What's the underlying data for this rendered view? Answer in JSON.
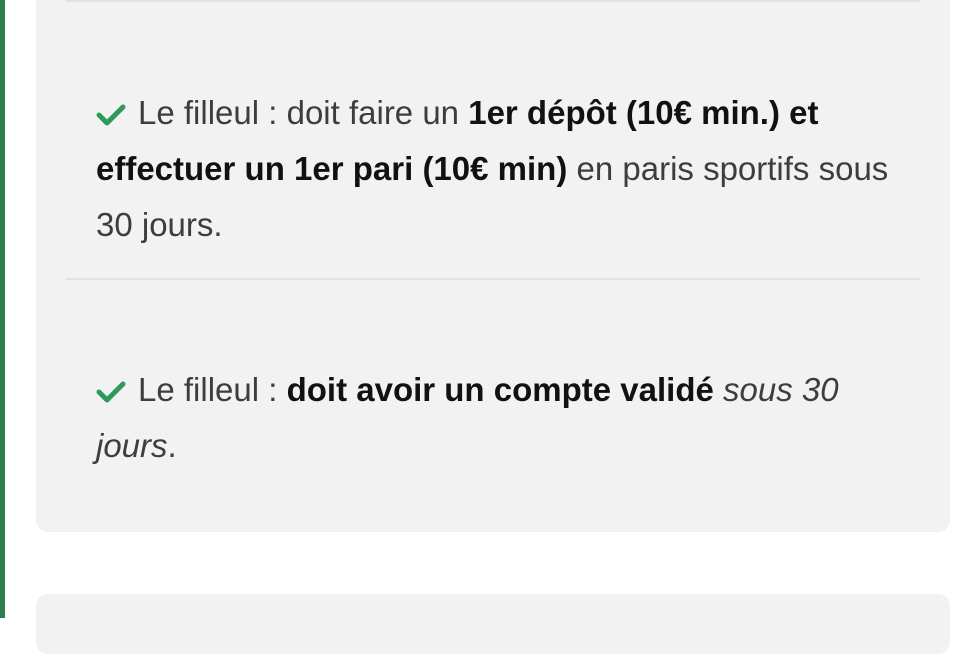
{
  "accent_color": "#2e7d4f",
  "check_color": "#2e9a5c",
  "conditions": [
    {
      "icon": "check-icon",
      "prefix": "Le filleul : ",
      "part1": "doit faire un ",
      "bold1": "1er dépôt (10€ min.) et effectuer un 1er pari (10€ min)",
      "part2": " en paris sportifs sous 30 jours."
    },
    {
      "icon": "check-icon",
      "prefix": "Le filleul : ",
      "bold1": "doit avoir un compte validé",
      "italic1": " sous 30 jours",
      "end": "."
    }
  ]
}
